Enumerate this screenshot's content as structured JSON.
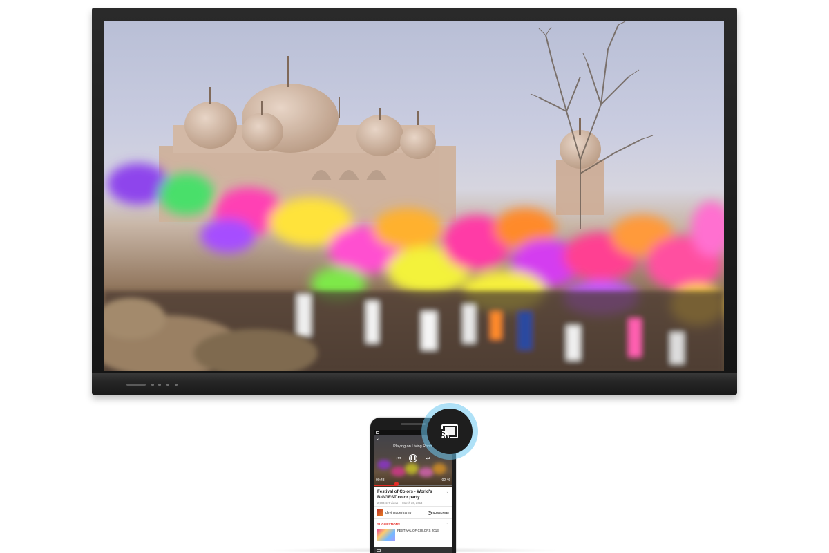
{
  "tv": {
    "screen_content": "festival-video-frame"
  },
  "phone": {
    "player": {
      "playing_on": "Playing on Living Room",
      "current_time": "00:48",
      "duration": "02:46",
      "progress_fraction": 0.29
    },
    "video": {
      "title": "Festival of Colors - World's BIGGEST color party",
      "views": "2,993,417 views",
      "date": "March 26, 2013"
    },
    "channel": {
      "name": "devinsupertramp",
      "subscribe_label": "SUBSCRIBE"
    },
    "suggestions": {
      "label": "SUGGESTIONS",
      "items": [
        {
          "title": "FESTIVAL OF COLORS 2013",
          "subtitle": ""
        }
      ]
    }
  },
  "cast": {
    "icon": "cast-icon",
    "halo_color": "#6ec8f0",
    "button_color": "#1e1e1e"
  },
  "colors": {
    "accent_red": "#e52d27"
  }
}
